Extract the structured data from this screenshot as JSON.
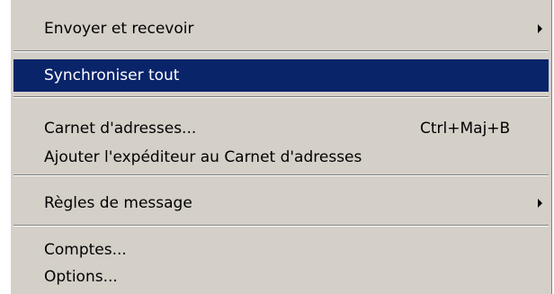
{
  "colors": {
    "menu_background": "#d4d0c8",
    "highlight": "#0a246a",
    "highlight_text": "#ffffff",
    "text": "#000000"
  },
  "menu": {
    "send_receive": {
      "label": "Envoyer et recevoir",
      "submenu_icon": "chevron-right-icon"
    },
    "sync_all": {
      "label": "Synchroniser tout",
      "state": "highlighted"
    },
    "address_book": {
      "label": "Carnet d'adresses...",
      "shortcut": "Ctrl+Maj+B"
    },
    "add_sender": {
      "label": "Ajouter l'expéditeur au Carnet d'adresses"
    },
    "message_rules": {
      "label": "Règles de message",
      "submenu_icon": "chevron-right-icon"
    },
    "accounts": {
      "label": "Comptes..."
    },
    "options": {
      "label": "Options..."
    }
  }
}
